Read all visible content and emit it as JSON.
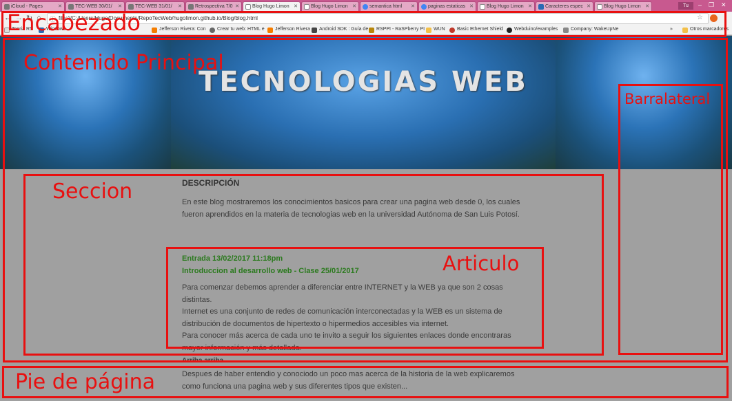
{
  "browser": {
    "tabs": [
      {
        "label": "iCloud - Pages"
      },
      {
        "label": "TEC-WEB 30/01/"
      },
      {
        "label": "TEC-WEB 31/01/"
      },
      {
        "label": "Retrospectiva 7/0"
      },
      {
        "label": "Blog Hugo Limon"
      },
      {
        "label": "Blog Hugo Limon"
      },
      {
        "label": "semantica html"
      },
      {
        "label": "paginas estaticas"
      },
      {
        "label": "Blog Hugo Limon"
      },
      {
        "label": "Caracteres espec"
      },
      {
        "label": "Blog Hugo Limon"
      }
    ],
    "user_badge": "Tu",
    "window_controls": {
      "minimize": "–",
      "maximize": "❐",
      "close": "✕"
    },
    "url": "file:///C:/Users/Hugo/Documents/RepoTecWeb/hugolimon.github.io/Blog/blog.html",
    "bookmarks": [
      {
        "label": "Teoria RS"
      },
      {
        "label": "Windows"
      },
      {
        "label": "Jefferson Rivera: Con"
      },
      {
        "label": "Crear tu web: HTML e"
      },
      {
        "label": "Jefferson Rivera"
      },
      {
        "label": "Android SDK : Guía de"
      },
      {
        "label": "RSPPI - RaSPberry PI"
      },
      {
        "label": "WUN"
      },
      {
        "label": "Basic Ethernet Shield"
      },
      {
        "label": "Webduino/examples"
      },
      {
        "label": "Company: WakeUpNe"
      }
    ],
    "bookmarks_more": "»",
    "other_bookmarks": "Otros marcadores"
  },
  "page": {
    "banner_title": "TECNOLOGIAS WEB",
    "description": {
      "heading": "DESCRIPCIÓN",
      "text_line1": "En este blog mostraremos los conocimientos basicos para crear una pagina web desde 0, los cuales",
      "text_line2": "fueron aprendidos en la materia de tecnologias web en la universidad Autónoma de San Luis Potosí."
    },
    "article": {
      "date": "Entrada 13/02/2017 11:18pm",
      "title": "Introduccion al desarrollo web - Clase 25/01/2017",
      "lines": [
        "Para comenzar debemos aprender a diferenciar entre INTERNET y la WEB ya que son 2 cosas",
        "distintas.",
        "Internet es una conjunto de redes de comunicación interconectadas y la WEB es un sistema de",
        "distribución de documentos de hipertexto o hipermedios accesibles via internet.",
        "Para conocer más acerca de cada uno te invito a seguir los siguientes enlaces donde encontraras",
        "mayor información y más detallada."
      ]
    },
    "next_entry_partial": "Arriba arriba",
    "footer_lines": [
      "Despues de haber entendio y conociodo un poco mas acerca de la historia de la web explicaremos",
      "como funciona una pagina web y sus diferentes tipos que existen..."
    ]
  },
  "annotations": {
    "encabezado": "Encabezado",
    "contenido_principal": "Contenido Principal",
    "barralateral": "Barralateral",
    "seccion": "Seccion",
    "articulo": "Articulo",
    "pie_de_pagina": "Pie de página"
  },
  "colors": {
    "annotation": "#e81010",
    "entry_green": "#2b7a1e",
    "tabbar": "#c8598f"
  }
}
